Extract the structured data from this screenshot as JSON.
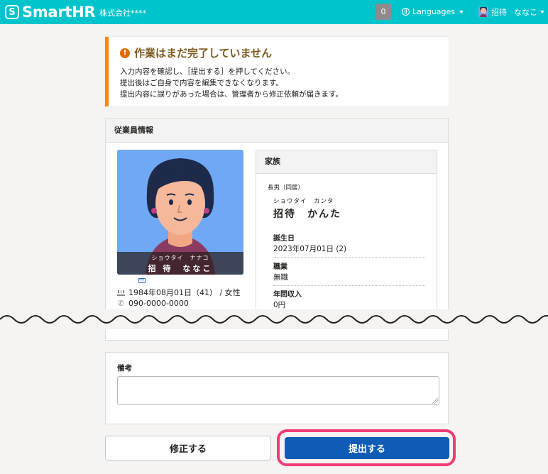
{
  "header": {
    "logo_symbol": "S",
    "logo_text": "SmartHR",
    "company": "株式会社****",
    "notification_count": "0",
    "languages_label": "Languages",
    "user_last_name": "招待",
    "user_first_name": "ななこ",
    "bg_color": "#00c4cc"
  },
  "alert": {
    "icon": "!",
    "title": "作業はまだ完了していません",
    "lines": [
      "入力内容を確認し、［提出する］を押してください。",
      "提出後はご自身で内容を編集できなくなります。",
      "提出内容に誤りがあった場合は、管理者から修正依頼が届きます。"
    ],
    "accent_color": "#ff8800"
  },
  "employee": {
    "section_title": "従業員情報",
    "name_kana": "ショウタイ　ナナコ",
    "name": "招 待　ななこ",
    "birth_info": "1984年08月01日（41） / 女性",
    "phone": "090-0000-0000"
  },
  "family": {
    "section_title": "家族",
    "relation": "長男（同居）",
    "name_kana": "ショウタイ　カンタ",
    "name": "招待　かんた",
    "fields": [
      {
        "label": "誕生日",
        "value": "2023年07月01日 (2)"
      },
      {
        "label": "職業",
        "value": "無職"
      },
      {
        "label": "年間収入",
        "value": "0円"
      }
    ]
  },
  "notes": {
    "label": "備考",
    "value": ""
  },
  "actions": {
    "fix_label": "修正する",
    "submit_label": "提出する",
    "submit_color": "#0f5bb5",
    "highlight_color": "#ef3d74"
  }
}
